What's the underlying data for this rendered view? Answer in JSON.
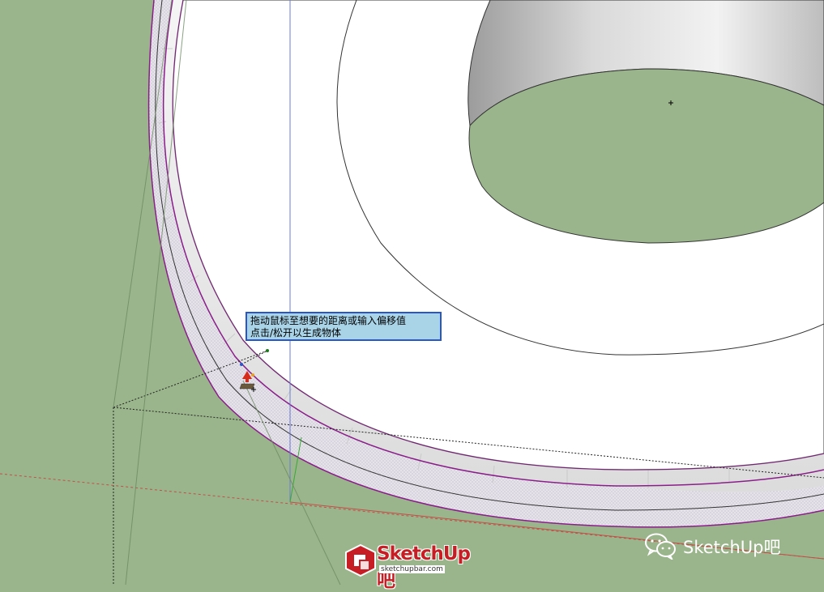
{
  "app": "SketchUp",
  "tooltip": {
    "line1": "拖动鼠标至想要的距离或输入偏移值",
    "line2": "点击/松开以生成物体"
  },
  "watermark": {
    "brand": "SketchUp",
    "brand_suffix": "吧",
    "url": "sketchupbar.com",
    "wechat_label": "SketchUp吧"
  },
  "colors": {
    "ground": "#9ab58b",
    "tooltip_bg": "#a9d4e8",
    "tooltip_border": "#2a56c6",
    "edge_selected": "#8a1e8a",
    "brand_red": "#c61e24"
  },
  "icons": [
    "push-pull-cursor-icon",
    "wechat-icon",
    "sketchup-logo-icon"
  ]
}
